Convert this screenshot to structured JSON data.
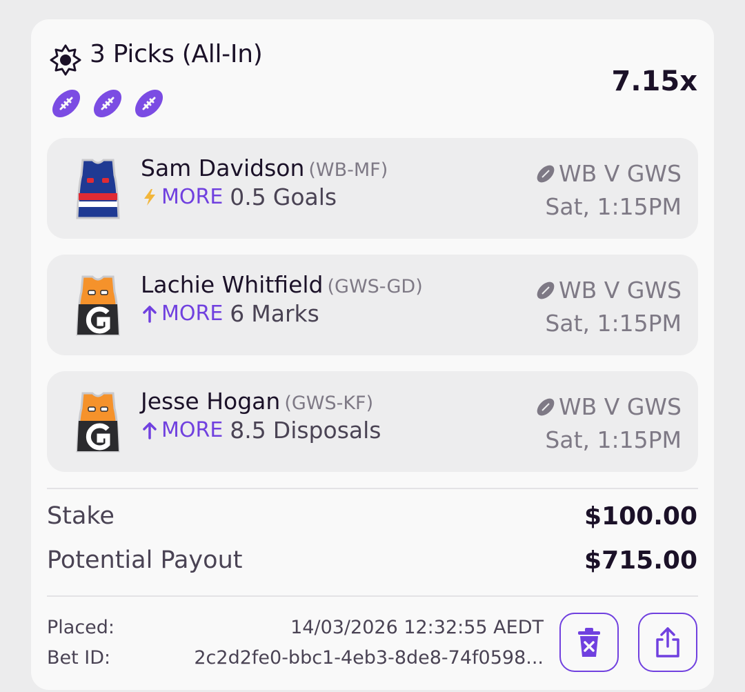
{
  "bet": {
    "title": "3 Picks (All-In)",
    "multiplier": "7.15x",
    "sport_icons": [
      "football-icon",
      "football-icon",
      "football-icon"
    ]
  },
  "picks": [
    {
      "player": "Sam Davidson",
      "team_pos": "(WB-MF)",
      "direction_icon": "lightning-icon",
      "direction": "MORE",
      "value": "0.5",
      "stat": "Goals",
      "match": "WB V GWS",
      "time": "Sat, 1:15PM",
      "jersey": "western-bulldogs-jersey"
    },
    {
      "player": "Lachie Whitfield",
      "team_pos": "(GWS-GD)",
      "direction_icon": "arrow-up-icon",
      "direction": "MORE",
      "value": "6",
      "stat": "Marks",
      "match": "WB V GWS",
      "time": "Sat, 1:15PM",
      "jersey": "gws-giants-jersey"
    },
    {
      "player": "Jesse Hogan",
      "team_pos": "(GWS-KF)",
      "direction_icon": "arrow-up-icon",
      "direction": "MORE",
      "value": "8.5",
      "stat": "Disposals",
      "match": "WB V GWS",
      "time": "Sat, 1:15PM",
      "jersey": "gws-giants-jersey"
    }
  ],
  "summary": {
    "stake_label": "Stake",
    "stake": "$100.00",
    "payout_label": "Potential Payout",
    "payout": "$715.00"
  },
  "meta": {
    "placed_label": "Placed:",
    "placed": "14/03/2026 12:32:55 AEDT",
    "bet_id_label": "Bet ID:",
    "bet_id": "2c2d2fe0-bbc1-4eb3-8de8-74f0598..."
  },
  "actions": {
    "delete_icon": "trash-icon",
    "share_icon": "share-icon"
  },
  "colors": {
    "accent": "#7040df",
    "text": "#1b1128",
    "muted": "#7e7985",
    "card": "#f9f9f9",
    "pick_bg": "#ededee"
  }
}
